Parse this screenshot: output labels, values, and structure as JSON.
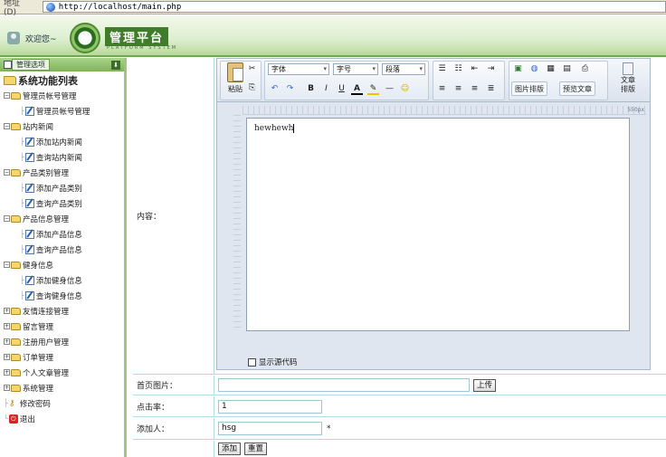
{
  "browser": {
    "address_label": "地址 (D)",
    "url": "http://localhost/main.php"
  },
  "header": {
    "greeting": "欢迎您~",
    "logo_title": "管理平台",
    "logo_subtitle": "PLATFORM SYSTEM"
  },
  "sidebar": {
    "options_label": "管理选项",
    "root_label": "系统功能列表",
    "items": [
      {
        "label": "管理员帐号管理",
        "level": 1,
        "type": "folder-open"
      },
      {
        "label": "管理员帐号管理",
        "level": 2,
        "type": "doc"
      },
      {
        "label": "站内新闻",
        "level": 1,
        "type": "folder-open"
      },
      {
        "label": "添加站内新闻",
        "level": 2,
        "type": "doc"
      },
      {
        "label": "查询站内新闻",
        "level": 2,
        "type": "doc"
      },
      {
        "label": "产品类别管理",
        "level": 1,
        "type": "folder-open"
      },
      {
        "label": "添加产品类别",
        "level": 2,
        "type": "doc"
      },
      {
        "label": "查询产品类别",
        "level": 2,
        "type": "doc"
      },
      {
        "label": "产品信息管理",
        "level": 1,
        "type": "folder-open"
      },
      {
        "label": "添加产品信息",
        "level": 2,
        "type": "doc"
      },
      {
        "label": "查询产品信息",
        "level": 2,
        "type": "doc"
      },
      {
        "label": "健身信息",
        "level": 1,
        "type": "folder-open"
      },
      {
        "label": "添加健身信息",
        "level": 2,
        "type": "doc"
      },
      {
        "label": "查询健身信息",
        "level": 2,
        "type": "doc"
      },
      {
        "label": "友情连接管理",
        "level": 1,
        "type": "folder"
      },
      {
        "label": "留言管理",
        "level": 1,
        "type": "folder"
      },
      {
        "label": "注册用户管理",
        "level": 1,
        "type": "folder"
      },
      {
        "label": "订单管理",
        "level": 1,
        "type": "folder"
      },
      {
        "label": "个人文章管理",
        "level": 1,
        "type": "folder"
      },
      {
        "label": "系统管理",
        "level": 1,
        "type": "folder"
      },
      {
        "label": "修改密码",
        "level": 1,
        "type": "key"
      },
      {
        "label": "退出",
        "level": 1,
        "type": "exit"
      }
    ]
  },
  "editor": {
    "paste_label": "粘贴",
    "font_select": "字体",
    "size_select": "字号",
    "paragraph_select": "段落",
    "image_layout_label": "图片排版",
    "preview_label": "预览文章",
    "article_layout_label": "文章\n排版",
    "ruler_label": "550px",
    "content": "hewhewh",
    "show_source_label": "显示源代码"
  },
  "form": {
    "content_label": "内容：",
    "image_label": "首页图片：",
    "image_value": "",
    "upload_label": "上传",
    "clicks_label": "点击率：",
    "clicks_value": "1",
    "author_label": "添加人：",
    "author_value": "hsg",
    "required_mark": "*",
    "add_label": "添加",
    "reset_label": "重置"
  },
  "colors": {
    "accent_green": "#6ea94a",
    "border_blue": "#b4dce8"
  }
}
